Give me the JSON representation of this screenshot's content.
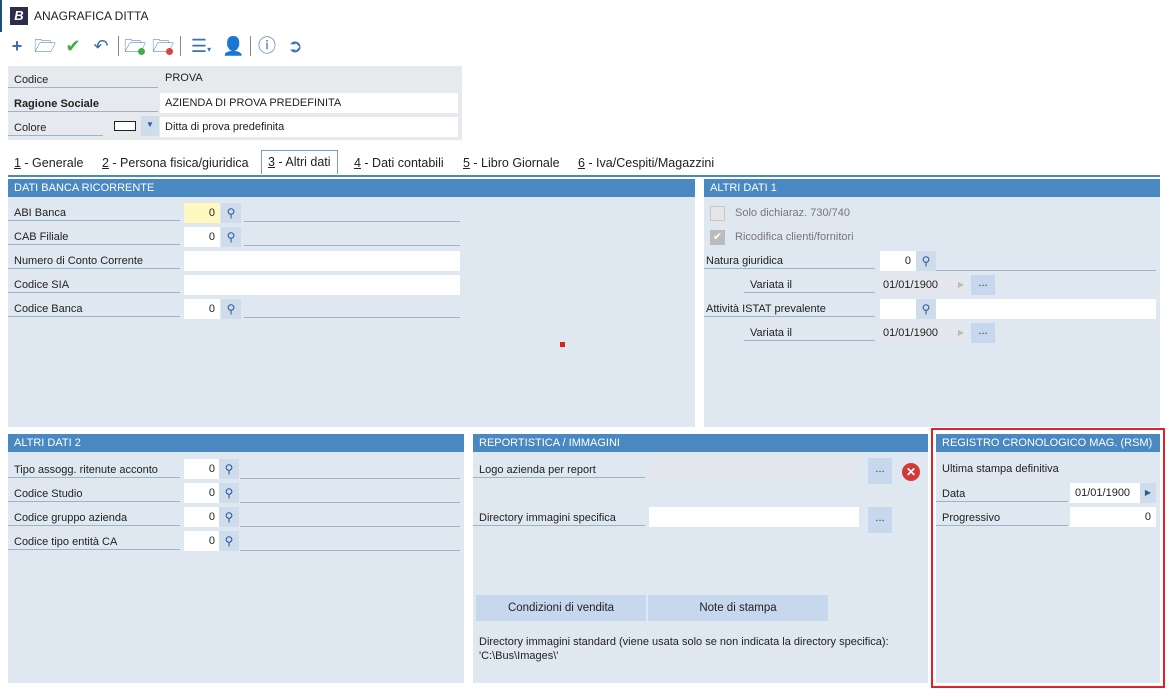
{
  "window": {
    "title": "ANAGRAFICA DITTA",
    "logo": "B"
  },
  "toolbar": {
    "icons": [
      "plus-icon",
      "folder-open-icon",
      "check-icon",
      "undo-icon",
      "folder-green-icon",
      "folder-red-icon",
      "menu-icon",
      "user-icon",
      "help-icon",
      "exit-icon"
    ]
  },
  "header": {
    "codice_label": "Codice",
    "codice_value": "PROVA",
    "ragione_label": "Ragione Sociale",
    "ragione_value": "AZIENDA DI PROVA PREDEFINITA",
    "colore_label": "Colore",
    "colore_value": "Ditta di prova predefinita"
  },
  "tabs": [
    {
      "num": "1",
      "label": " - Generale"
    },
    {
      "num": "2",
      "label": " - Persona fisica/giuridica"
    },
    {
      "num": "3",
      "label": " - Altri dati"
    },
    {
      "num": "4",
      "label": " - Dati contabili"
    },
    {
      "num": "5",
      "label": " - Libro Giornale"
    },
    {
      "num": "6",
      "label": " - Iva/Cespiti/Magazzini"
    }
  ],
  "banca": {
    "title": "DATI BANCA RICORRENTE",
    "abi_label": "ABI Banca",
    "abi_value": "0",
    "cab_label": "CAB Filiale",
    "cab_value": "0",
    "conto_label": "Numero di Conto Corrente",
    "conto_value": "",
    "sia_label": "Codice SIA",
    "sia_value": "",
    "codbanca_label": "Codice Banca",
    "codbanca_value": "0"
  },
  "altri1": {
    "title": "ALTRI DATI 1",
    "solo_label": "Solo dichiaraz. 730/740",
    "solo_checked": false,
    "ricodifica_label": "Ricodifica clienti/fornitori",
    "ricodifica_checked": true,
    "natura_label": "Natura giuridica",
    "natura_value": "0",
    "variata1_label": "Variata il",
    "variata1_value": "01/01/1900",
    "istat_label": "Attività ISTAT prevalente",
    "istat_value": "",
    "variata2_label": "Variata il",
    "variata2_value": "01/01/1900",
    "dots": "..."
  },
  "altri2": {
    "title": "ALTRI DATI 2",
    "rows": [
      {
        "label": "Tipo assogg. ritenute acconto",
        "value": "0"
      },
      {
        "label": "Codice Studio",
        "value": "0"
      },
      {
        "label": "Codice gruppo azienda",
        "value": "0"
      },
      {
        "label": "Codice tipo entità CA",
        "value": "0"
      }
    ]
  },
  "report": {
    "title": "REPORTISTICA / IMMAGINI",
    "logo_label": "Logo azienda per report",
    "logo_value": "",
    "dir_label": "Directory immagini specifica",
    "dir_value": "",
    "dots": "...",
    "condizioni_label": "Condizioni di vendita",
    "note_label": "Note di stampa",
    "info_line1": "Directory immagini standard (viene usata solo se non indicata la directory specifica):",
    "info_line2": "'C:\\Bus\\Images\\'"
  },
  "registro": {
    "title": "REGISTRO CRONOLOGICO MAG. (RSM)",
    "subtitle": "Ultima stampa definitiva",
    "data_label": "Data",
    "data_value": "01/01/1900",
    "progressivo_label": "Progressivo",
    "progressivo_value": "0",
    "highlight_color": "#e0202a"
  }
}
